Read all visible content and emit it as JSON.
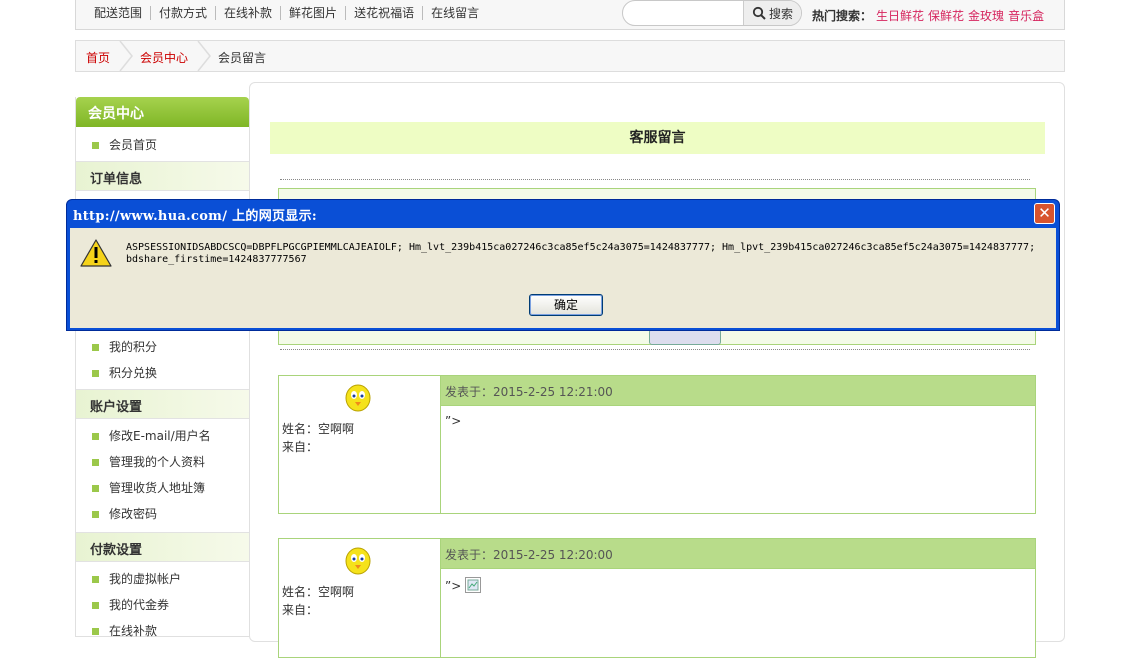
{
  "topnav": {
    "links": [
      "配送范围",
      "付款方式",
      "在线补款",
      "鲜花图片",
      "送花祝福语",
      "在线留言"
    ],
    "search_placeholder": "",
    "search_label": "搜索",
    "hot_label": "热门搜索：",
    "hot_keywords": [
      "生日鲜花",
      "保鲜花",
      "金玫瑰",
      "音乐盒"
    ]
  },
  "breadcrumb": [
    "首页",
    "会员中心",
    "会员留言"
  ],
  "sidebar": {
    "title": "会员中心",
    "home": "会员首页",
    "sections": [
      {
        "title": "订单信息",
        "items": []
      },
      {
        "title": "",
        "items": [
          "我的积分",
          "积分兑换"
        ]
      },
      {
        "title": "账户设置",
        "items": [
          "修改E-mail/用户名",
          "管理我的个人资料",
          "管理收货人地址簿",
          "修改密码"
        ]
      },
      {
        "title": "付款设置",
        "items": [
          "我的虚拟帐户",
          "我的代金券",
          "在线补款"
        ]
      }
    ]
  },
  "main": {
    "title": "客服留言",
    "messages": [
      {
        "posted": "发表于：2015-2-25 12:21:00",
        "name": "姓名：空啊啊",
        "from": "来自：",
        "body": "”>"
      },
      {
        "posted": "发表于：2015-2-25 12:20:00",
        "name": "姓名：空啊啊",
        "from": "来自：",
        "body": "”>"
      }
    ]
  },
  "dialog": {
    "title": "http://www.hua.com/ 上的网页显示:",
    "message": "ASPSESSIONIDSABDCSCQ=DBPFLPGCGPIEMMLCAJEAIOLF; Hm_lvt_239b415ca027246c3ca85ef5c24a3075=1424837777; Hm_lpvt_239b415ca027246c3ca85ef5c24a3075=1424837777; bdshare_firstime=1424837777567",
    "ok_label": "确定"
  },
  "colors": {
    "accent": "#d6265f",
    "green": "#9bc84a",
    "dialog_blue": "#0a4fd6"
  }
}
